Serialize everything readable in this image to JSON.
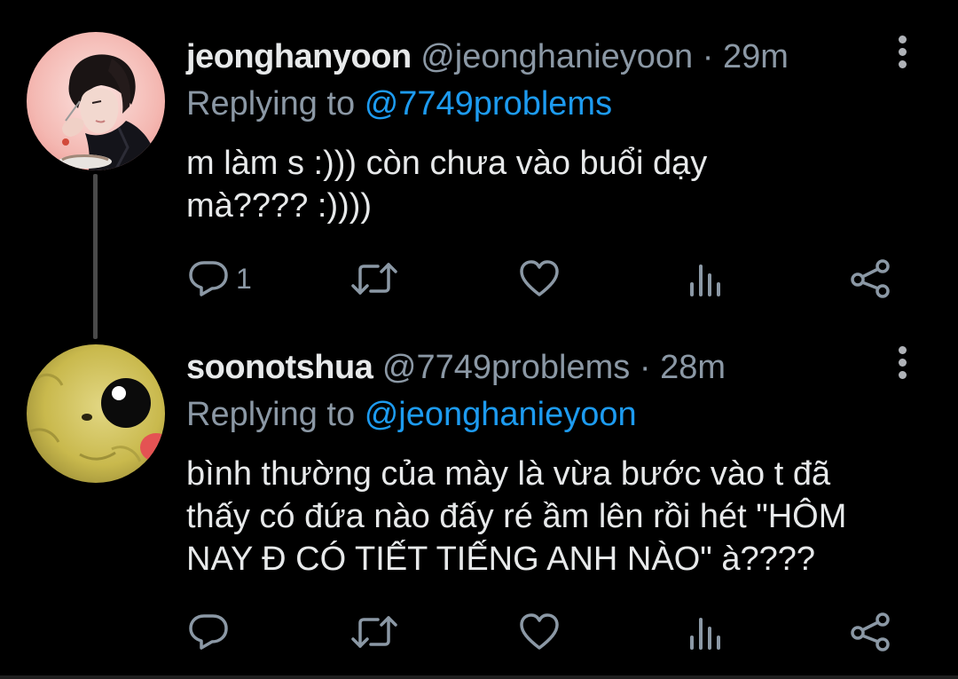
{
  "tweets": [
    {
      "display_name": "jeonghanyoon",
      "handle": "@jeonghanieyoon",
      "separator": "·",
      "time": "29m",
      "replying_label": "Replying to",
      "replying_to": "@7749problems",
      "text_lines": [
        "m làm s :))) còn chưa vào buổi dạy",
        "mà???? :))))"
      ],
      "reply_count": "1",
      "avatar": "profile-photo"
    },
    {
      "display_name": "soonotshua",
      "handle": "@7749problems",
      "separator": "·",
      "time": "28m",
      "replying_label": "Replying to",
      "replying_to": "@jeonghanieyoon",
      "text_lines": [
        "bình thường của mày là vừa bước vào t đã",
        "thấy có đứa nào đấy ré ầm lên rồi hét \"HÔM",
        "NAY Đ CÓ TIẾT TIẾNG ANH NÀO\" à????"
      ],
      "reply_count": "",
      "avatar": "pikachu-plush-photo"
    }
  ],
  "icons": {
    "reply": "reply-icon",
    "retweet": "retweet-icon",
    "like": "heart-icon",
    "stats": "analytics-icon",
    "share": "share-icon",
    "more": "more-vertical-icon"
  },
  "colors": {
    "background": "#000000",
    "text": "#e7e9ea",
    "secondary": "#8b98a5",
    "link": "#1d9bf0",
    "thread_line": "#4a4a4a"
  }
}
